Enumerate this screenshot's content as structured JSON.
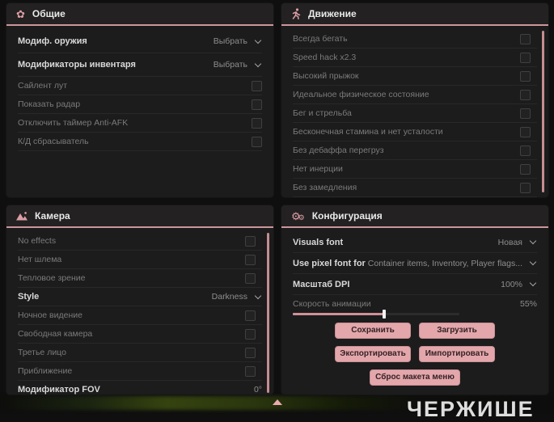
{
  "colors": {
    "accent": "#cd969b",
    "button": "#e3a7ab",
    "panel": "#1c1c1c",
    "background": "#0f0f0f"
  },
  "watermark": {
    "text": "ЧЕРЖИШЕ"
  },
  "panels": {
    "general": {
      "title": "Общие",
      "icon": "gear-flower-icon",
      "rows": [
        {
          "type": "dropdown",
          "label": "Модиф. оружия",
          "value": "Выбрать"
        },
        {
          "type": "dropdown",
          "label": "Модификаторы инвентаря",
          "value": "Выбрать"
        },
        {
          "type": "checkbox",
          "label": "Сайлент лут",
          "checked": false
        },
        {
          "type": "checkbox",
          "label": "Показать радар",
          "checked": false
        },
        {
          "type": "checkbox",
          "label": "Отключить таймер Anti-AFK",
          "checked": false
        },
        {
          "type": "checkbox",
          "label": "К/Д сбрасыватель",
          "checked": false
        }
      ]
    },
    "movement": {
      "title": "Движение",
      "icon": "runner-icon",
      "rows": [
        {
          "type": "checkbox",
          "label": "Всегда бегать",
          "checked": false
        },
        {
          "type": "checkbox",
          "label": "Speed hack x2.3",
          "checked": false
        },
        {
          "type": "checkbox",
          "label": "Высокий прыжок",
          "checked": false
        },
        {
          "type": "checkbox",
          "label": "Идеальное физическое состояние",
          "checked": false
        },
        {
          "type": "checkbox",
          "label": "Бег и стрельба",
          "checked": false
        },
        {
          "type": "checkbox",
          "label": "Бесконечная стамина и нет усталости",
          "checked": false
        },
        {
          "type": "checkbox",
          "label": "Без дебаффа перегруз",
          "checked": false
        },
        {
          "type": "checkbox",
          "label": "Нет инерции",
          "checked": false
        },
        {
          "type": "checkbox",
          "label": "Без замедления",
          "checked": false
        }
      ]
    },
    "camera": {
      "title": "Камера",
      "icon": "image-icon",
      "rows": [
        {
          "type": "checkbox",
          "label": "No effects",
          "checked": false
        },
        {
          "type": "checkbox",
          "label": "Нет шлема",
          "checked": false
        },
        {
          "type": "checkbox",
          "label": "Тепловое зрение",
          "checked": false
        },
        {
          "type": "dropdown",
          "label": "Style",
          "value": "Darkness"
        },
        {
          "type": "checkbox",
          "label": "Ночное видение",
          "checked": false
        },
        {
          "type": "checkbox",
          "label": "Свободная камера",
          "checked": false
        },
        {
          "type": "checkbox",
          "label": "Третье лицо",
          "checked": false
        },
        {
          "type": "checkbox",
          "label": "Приближение",
          "checked": false
        },
        {
          "type": "slider",
          "label": "Модификатор FOV",
          "value": "0°",
          "percent": 0
        }
      ]
    },
    "config": {
      "title": "Конфигурация",
      "icon": "gears-icon",
      "rows": [
        {
          "type": "dropdown",
          "label": "Visuals font",
          "value": "Новая"
        },
        {
          "type": "dropdown",
          "label": "Use pixel font for",
          "value": "Container items, Inventory, Player flags..."
        },
        {
          "type": "dropdown",
          "label": "Масштаб DPI",
          "value": "100%"
        },
        {
          "type": "slider",
          "label": "Скорость анимации",
          "value": "55%",
          "percent": 55
        }
      ],
      "buttons": [
        "Сохранить",
        "Загрузить",
        "Экспортировать",
        "Импортировать",
        "Сброс макета меню"
      ]
    }
  }
}
